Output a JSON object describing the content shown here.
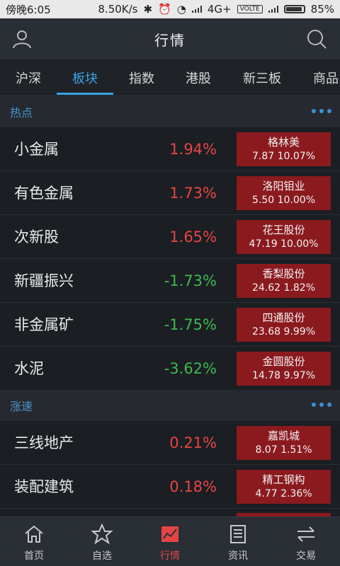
{
  "status": {
    "time": "傍晚6:05",
    "speed": "8.50K/s",
    "network": "4G+",
    "volte": "VOLTE",
    "battery": "85%"
  },
  "header": {
    "title": "行情",
    "left_icon": "user-icon",
    "right_icon": "search-icon"
  },
  "tabs": [
    {
      "label": "沪深",
      "active": false
    },
    {
      "label": "板块",
      "active": true
    },
    {
      "label": "指数",
      "active": false
    },
    {
      "label": "港股",
      "active": false
    },
    {
      "label": "新三板",
      "active": false
    },
    {
      "label": "商品",
      "active": false
    }
  ],
  "sections": [
    {
      "title": "热点",
      "rows": [
        {
          "name": "小金属",
          "pct": "1.94%",
          "dir": "up",
          "stock": "格林美",
          "price": "7.87",
          "change": "10.07%"
        },
        {
          "name": "有色金属",
          "pct": "1.73%",
          "dir": "up",
          "stock": "洛阳钼业",
          "price": "5.50",
          "change": "10.00%"
        },
        {
          "name": "次新股",
          "pct": "1.65%",
          "dir": "up",
          "stock": "花王股份",
          "price": "47.19",
          "change": "10.00%"
        },
        {
          "name": "新疆振兴",
          "pct": "-1.73%",
          "dir": "down",
          "stock": "香梨股份",
          "price": "24.62",
          "change": "1.82%"
        },
        {
          "name": "非金属矿",
          "pct": "-1.75%",
          "dir": "down",
          "stock": "四通股份",
          "price": "23.68",
          "change": "9.99%"
        },
        {
          "name": "水泥",
          "pct": "-3.62%",
          "dir": "down",
          "stock": "金圆股份",
          "price": "14.78",
          "change": "9.97%"
        }
      ]
    },
    {
      "title": "涨速",
      "rows": [
        {
          "name": "三线地产",
          "pct": "0.21%",
          "dir": "up",
          "stock": "嘉凯城",
          "price": "8.07",
          "change": "1.51%"
        },
        {
          "name": "装配建筑",
          "pct": "0.18%",
          "dir": "up",
          "stock": "精工钢构",
          "price": "4.77",
          "change": "2.36%"
        }
      ]
    }
  ],
  "nav": [
    {
      "label": "首页",
      "icon": "home-icon",
      "active": false
    },
    {
      "label": "自选",
      "icon": "star-icon",
      "active": false
    },
    {
      "label": "行情",
      "icon": "chart-icon",
      "active": true
    },
    {
      "label": "资讯",
      "icon": "news-icon",
      "active": false
    },
    {
      "label": "交易",
      "icon": "trade-icon",
      "active": false
    }
  ],
  "colors": {
    "up": "#e64545",
    "down": "#3fb84f",
    "accent": "#3aa3e6",
    "stock_bg": "#8b1a1f"
  }
}
